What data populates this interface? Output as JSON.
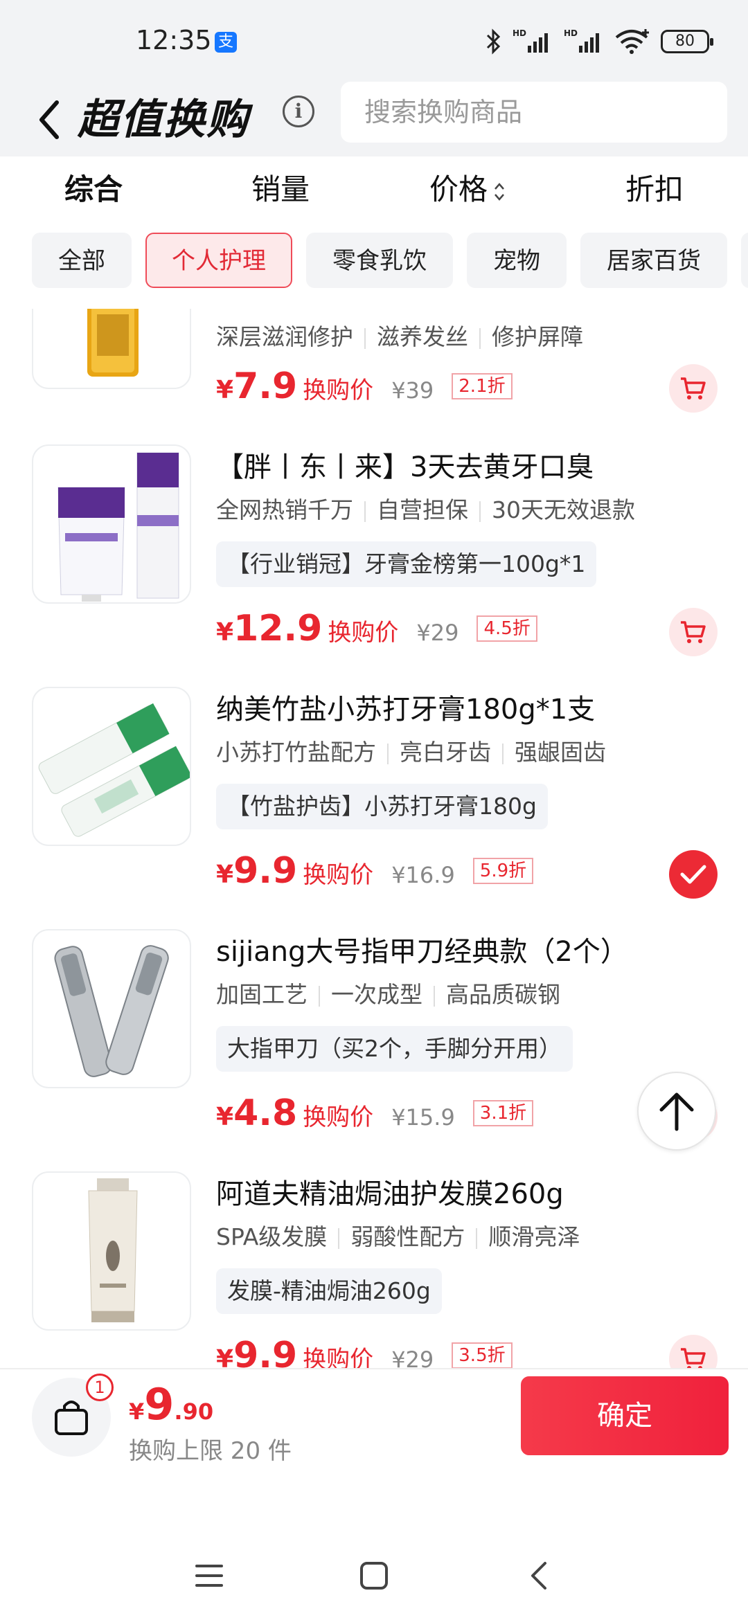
{
  "status_bar": {
    "time": "12:35",
    "app_badge": "支",
    "battery": "80"
  },
  "header": {
    "title": "超值换购",
    "info_icon": "i",
    "search_placeholder": "搜索换购商品"
  },
  "sort_tabs": [
    {
      "label": "综合",
      "active": true
    },
    {
      "label": "销量",
      "active": false
    },
    {
      "label": "价格",
      "active": false
    },
    {
      "label": "折扣",
      "active": false
    }
  ],
  "categories": [
    {
      "label": "全部",
      "active": false
    },
    {
      "label": "个人护理",
      "active": true
    },
    {
      "label": "零食乳饮",
      "active": false
    },
    {
      "label": "宠物",
      "active": false
    },
    {
      "label": "居家百货",
      "active": false
    }
  ],
  "products": [
    {
      "name": "",
      "tags": [
        "深层滋润修护",
        "滋养发丝",
        "修护屏障"
      ],
      "promo": "",
      "price_int": "7.9",
      "price_label": "换购价",
      "original": "¥39",
      "discount": "2.1折",
      "selected": false,
      "image": "hair-oil-bottle"
    },
    {
      "name": "【胖丨东丨来】3天去黄牙口臭",
      "tags": [
        "全网热销千万",
        "自营担保",
        "30天无效退款"
      ],
      "promo": "【行业销冠】牙膏金榜第一100g*1",
      "price_int": "12.9",
      "price_label": "换购价",
      "original": "¥29",
      "discount": "4.5折",
      "selected": false,
      "image": "toothpaste-purple"
    },
    {
      "name": "纳美竹盐小苏打牙膏180g*1支",
      "tags": [
        "小苏打竹盐配方",
        "亮白牙齿",
        "强龈固齿"
      ],
      "promo": "【竹盐护齿】小苏打牙膏180g",
      "price_int": "9.9",
      "price_label": "换购价",
      "original": "¥16.9",
      "discount": "5.9折",
      "selected": true,
      "image": "toothpaste-green"
    },
    {
      "name": "sijiang大号指甲刀经典款（2个）",
      "tags": [
        "加固工艺",
        "一次成型",
        "高品质碳钢"
      ],
      "promo": "大指甲刀（买2个，手脚分开用）",
      "price_int": "4.8",
      "price_label": "换购价",
      "original": "¥15.9",
      "discount": "3.1折",
      "selected": false,
      "image": "nail-clippers"
    },
    {
      "name": "阿道夫精油焗油护发膜260g",
      "tags": [
        "SPA级发膜",
        "弱酸性配方",
        "顺滑亮泽"
      ],
      "promo": "发膜-精油焗油260g",
      "price_int": "9.9",
      "price_label": "换购价",
      "original": "¥29",
      "discount": "3.5折",
      "selected": false,
      "image": "hair-mask-tube"
    }
  ],
  "bottom": {
    "badge_count": "1",
    "currency": "¥",
    "total_int": "9",
    "total_dec": ".90",
    "limit_text": "换购上限 20 件",
    "confirm_label": "确定"
  },
  "colors": {
    "accent": "#e8262f",
    "chip_active_bg": "#fde9ea",
    "header_bg": "#f2f3f5"
  }
}
